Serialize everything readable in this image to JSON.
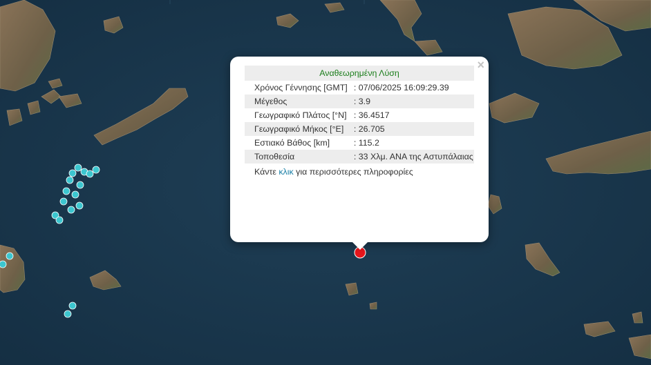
{
  "popup": {
    "title": "Αναθεωρημένη Λύση",
    "close_symbol": "×",
    "rows": [
      {
        "label": "Χρόνος Γέννησης [GMT]",
        "value": ": 07/06/2025 16:09:29.39"
      },
      {
        "label": "Μέγεθος",
        "value": ": 3.9"
      },
      {
        "label": "Γεωγραφικό Πλάτος [°N]",
        "value": ": 36.4517"
      },
      {
        "label": "Γεωγραφικό Μήκος [°E]",
        "value": ": 26.705"
      },
      {
        "label": "Εστιακό Βάθος [km]",
        "value": ": 115.2"
      },
      {
        "label": "Τοποθεσία",
        "value": ": 33 Χλμ. ΑΝΑ της Αστυπάλαιας"
      }
    ],
    "more_prefix": "Κάντε",
    "more_link": "κλικ",
    "more_suffix": "για περισσότερες πληροφορίες"
  },
  "markers": {
    "selected_event_color": "#e8161c",
    "other_event_color": "#3cc6cf"
  },
  "colors": {
    "sea": "#1c3a50",
    "land": "#7e6a52"
  }
}
